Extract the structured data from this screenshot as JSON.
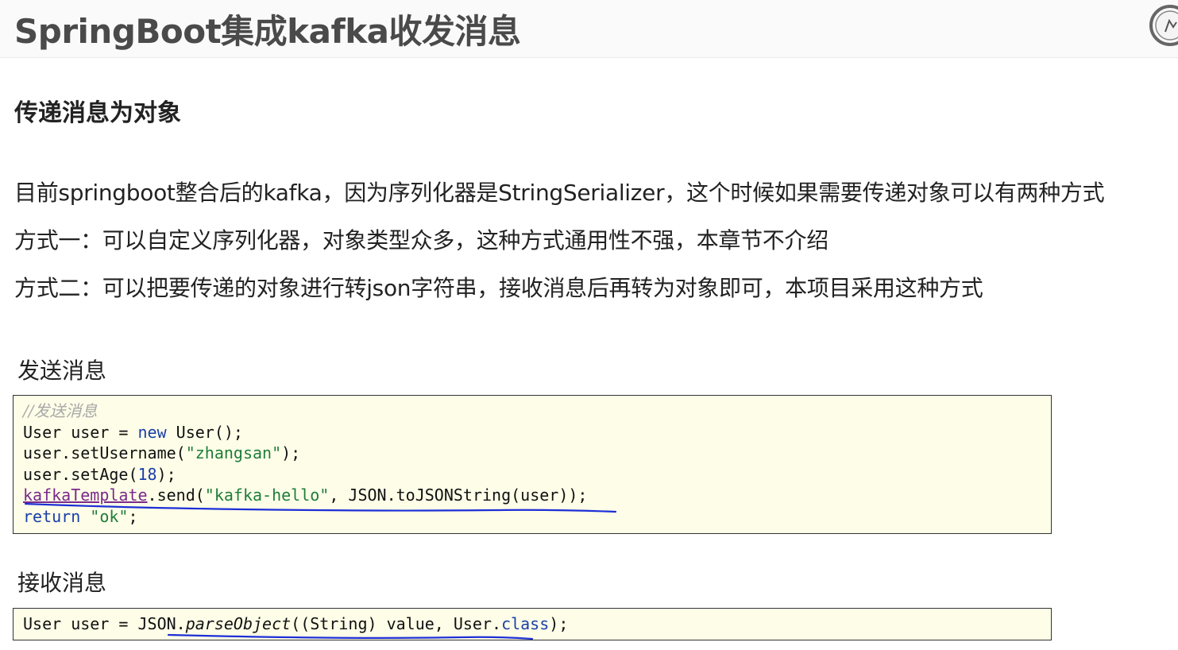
{
  "header": {
    "title": "SpringBoot集成kafka收发消息"
  },
  "section": {
    "heading": "传递消息为对象",
    "paragraphs": [
      "目前springboot整合后的kafka，因为序列化器是StringSerializer，这个时候如果需要传递对象可以有两种方式",
      "方式一：可以自定义序列化器，对象类型众多，这种方式通用性不强，本章节不介绍",
      "方式二：可以把要传递的对象进行转json字符串，接收消息后再转为对象即可，本项目采用这种方式"
    ]
  },
  "send": {
    "heading": "发送消息",
    "code": {
      "comment": "//发送消息",
      "line2_a": "User user = ",
      "line2_kw": "new",
      "line2_b": " User();",
      "line3_a": "user.setUsername(",
      "line3_str": "\"zhangsan\"",
      "line3_b": ");",
      "line4_a": "user.setAge(",
      "line4_num": "18",
      "line4_b": ");",
      "line5_field": "kafkaTemplate",
      "line5_a": ".send(",
      "line5_str": "\"kafka-hello\"",
      "line5_b": ", JSON.toJSONString(user));",
      "line6_kw": "return",
      "line6_sp": " ",
      "line6_str": "\"ok\"",
      "line6_b": ";"
    }
  },
  "receive": {
    "heading": "接收消息",
    "code": {
      "a": "User user = JSON.",
      "method": "parseObject",
      "b": "((String) value, User.",
      "kw": "class",
      "c": ");"
    }
  },
  "colors": {
    "code_background": "#fefde8",
    "keyword": "#1a3fa8",
    "string": "#1f7d3a",
    "comment": "#a8a8a8",
    "annotation_pen": "#1d2fd6"
  }
}
